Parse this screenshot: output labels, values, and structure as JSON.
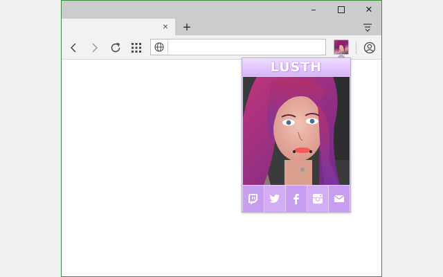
{
  "window": {
    "minimize_label": "−",
    "maximize_label": "☐",
    "close_label": "✕"
  },
  "tab": {
    "close_label": "×",
    "new_tab_label": "+"
  },
  "toolbar": {
    "address": "",
    "address_placeholder": ""
  },
  "popup": {
    "title": "LUSTH",
    "social": [
      {
        "name": "twitch-icon"
      },
      {
        "name": "twitter-icon"
      },
      {
        "name": "facebook-icon"
      },
      {
        "name": "instagram-icon"
      },
      {
        "name": "email-icon"
      }
    ]
  },
  "colors": {
    "accent_purple": "#c995f2",
    "header_light": "#f0ddff",
    "social_bg_1": "#c8a0f0",
    "social_bg_2": "#d6b4f6",
    "window_border": "#3c8a3c"
  }
}
